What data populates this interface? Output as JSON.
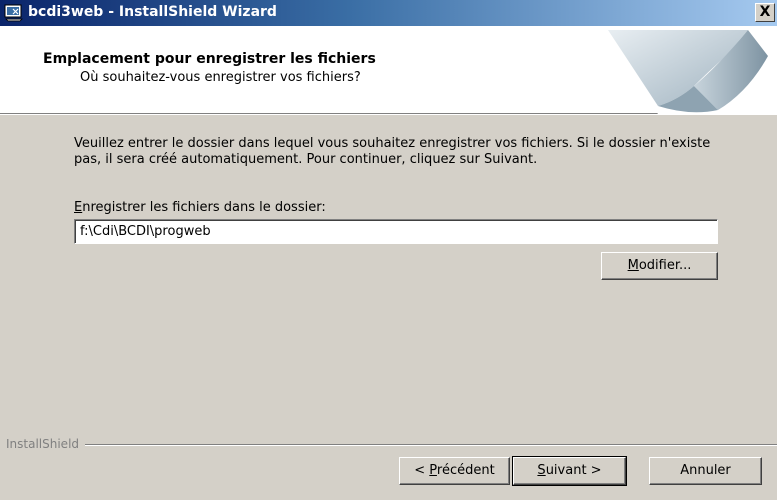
{
  "window": {
    "title": "bcdi3web - InstallShield Wizard",
    "close_label": "X"
  },
  "header": {
    "title": "Emplacement pour enregistrer les fichiers",
    "subtitle": "Où souhaitez-vous enregistrer vos fichiers?"
  },
  "main": {
    "instructions": "Veuillez entrer le dossier dans lequel vous souhaitez enregistrer vos fichiers. Si le dossier n'existe pas, il sera créé automatiquement. Pour continuer, cliquez sur Suivant.",
    "folder_label_mnemonic": "E",
    "folder_label_rest": "nregistrer les fichiers dans le dossier:",
    "folder_value": "f:\\Cdi\\BCDI\\progweb",
    "modify_mnemonic": "M",
    "modify_rest": "odifier..."
  },
  "footer": {
    "brand": "InstallShield",
    "back_prefix": "< ",
    "back_mnemonic": "P",
    "back_rest": "récédent",
    "next_mnemonic": "S",
    "next_rest": "uivant >",
    "cancel_label": "Annuler"
  },
  "colors": {
    "titlebar_start": "#0a246a",
    "titlebar_end": "#a6caf0",
    "face": "#d4d0c8"
  }
}
